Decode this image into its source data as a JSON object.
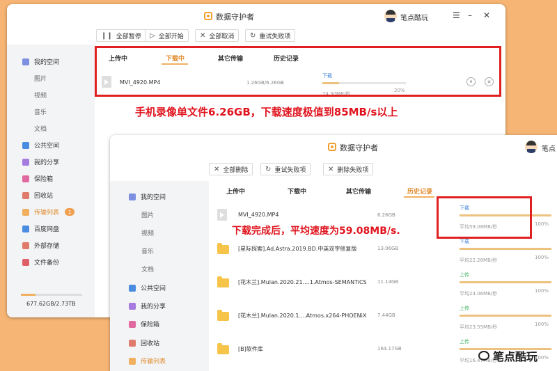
{
  "app": {
    "title": "数据守护者",
    "user": "笔点酷玩",
    "user_partial": "笔点"
  },
  "window_controls": {
    "menu": "☰",
    "minimize": "–",
    "close": "✕"
  },
  "toolbar1": {
    "pause_all": "全部暂停",
    "start_all": "全部开始",
    "cancel_all": "全部取消",
    "retry_failed": "重试失败项"
  },
  "toolbar2": {
    "delete_all": "全部删除",
    "retry_failed": "重试失败项",
    "delete_failed": "删除失败项"
  },
  "sidebar": {
    "my_space": "我的空间",
    "pictures": "图片",
    "videos": "视频",
    "music": "音乐",
    "docs": "文档",
    "public_space": "公共空间",
    "my_share": "我的分享",
    "safe": "保险箱",
    "recycle": "回收站",
    "transfer_list": "传输列表",
    "transfer_badge": "1",
    "baidu": "百度网盘",
    "external": "外部存储",
    "backup": "文件备份",
    "storage_text": "677.62GB/2.73TB",
    "storage_used_fraction": 0.24
  },
  "tabs": {
    "uploading": "上传中",
    "downloading": "下载中",
    "other": "其它传输",
    "history": "历史记录"
  },
  "win1_row": {
    "name": "MVI_4920.MP4",
    "size": "1.26GB/6.26GB",
    "direction": "下载",
    "speed": "74.30MB/秒",
    "percent": "20%",
    "progress": 0.2,
    "pause_icon": "⏸",
    "cancel_icon": "✕"
  },
  "annotation1": "手机录像单文件6.26GB，下载速度极值到85MB/s以上",
  "annotation2": "下载完成后，平均速度为59.08MB/s.",
  "history_rows": [
    {
      "name": "MVI_4920.MP4",
      "size": "6.26GB",
      "dir": "下载",
      "dir_type": "down",
      "speed": "平均59.08MB/秒",
      "pct": "100%",
      "type": "video"
    },
    {
      "name": "[星际探索].Ad.Astra.2019.BD.中英双字修复版",
      "size": "13.06GB",
      "dir": "下载",
      "dir_type": "down",
      "speed": "平均22.28MB/秒",
      "pct": "100%",
      "type": "folder"
    },
    {
      "name": "[花木兰].Mulan.2020.21....1.Atmos-SEMANTiCS",
      "size": "11.14GB",
      "dir": "上传",
      "dir_type": "up",
      "speed": "平均24.06MB/秒",
      "pct": "100%",
      "type": "folder"
    },
    {
      "name": "[花木兰].Mulan.2020.1....Atmos.x264-PHOENiX",
      "size": "7.44GB",
      "dir": "上传",
      "dir_type": "up",
      "speed": "平均23.55MB/秒",
      "pct": "100%",
      "type": "folder"
    },
    {
      "name": "[B]软件库",
      "size": "164.17GB",
      "dir": "上传",
      "dir_type": "up",
      "speed": "平均16.47MB/秒",
      "pct": "100%",
      "type": "folder"
    }
  ],
  "watermark": "笔点酷玩"
}
